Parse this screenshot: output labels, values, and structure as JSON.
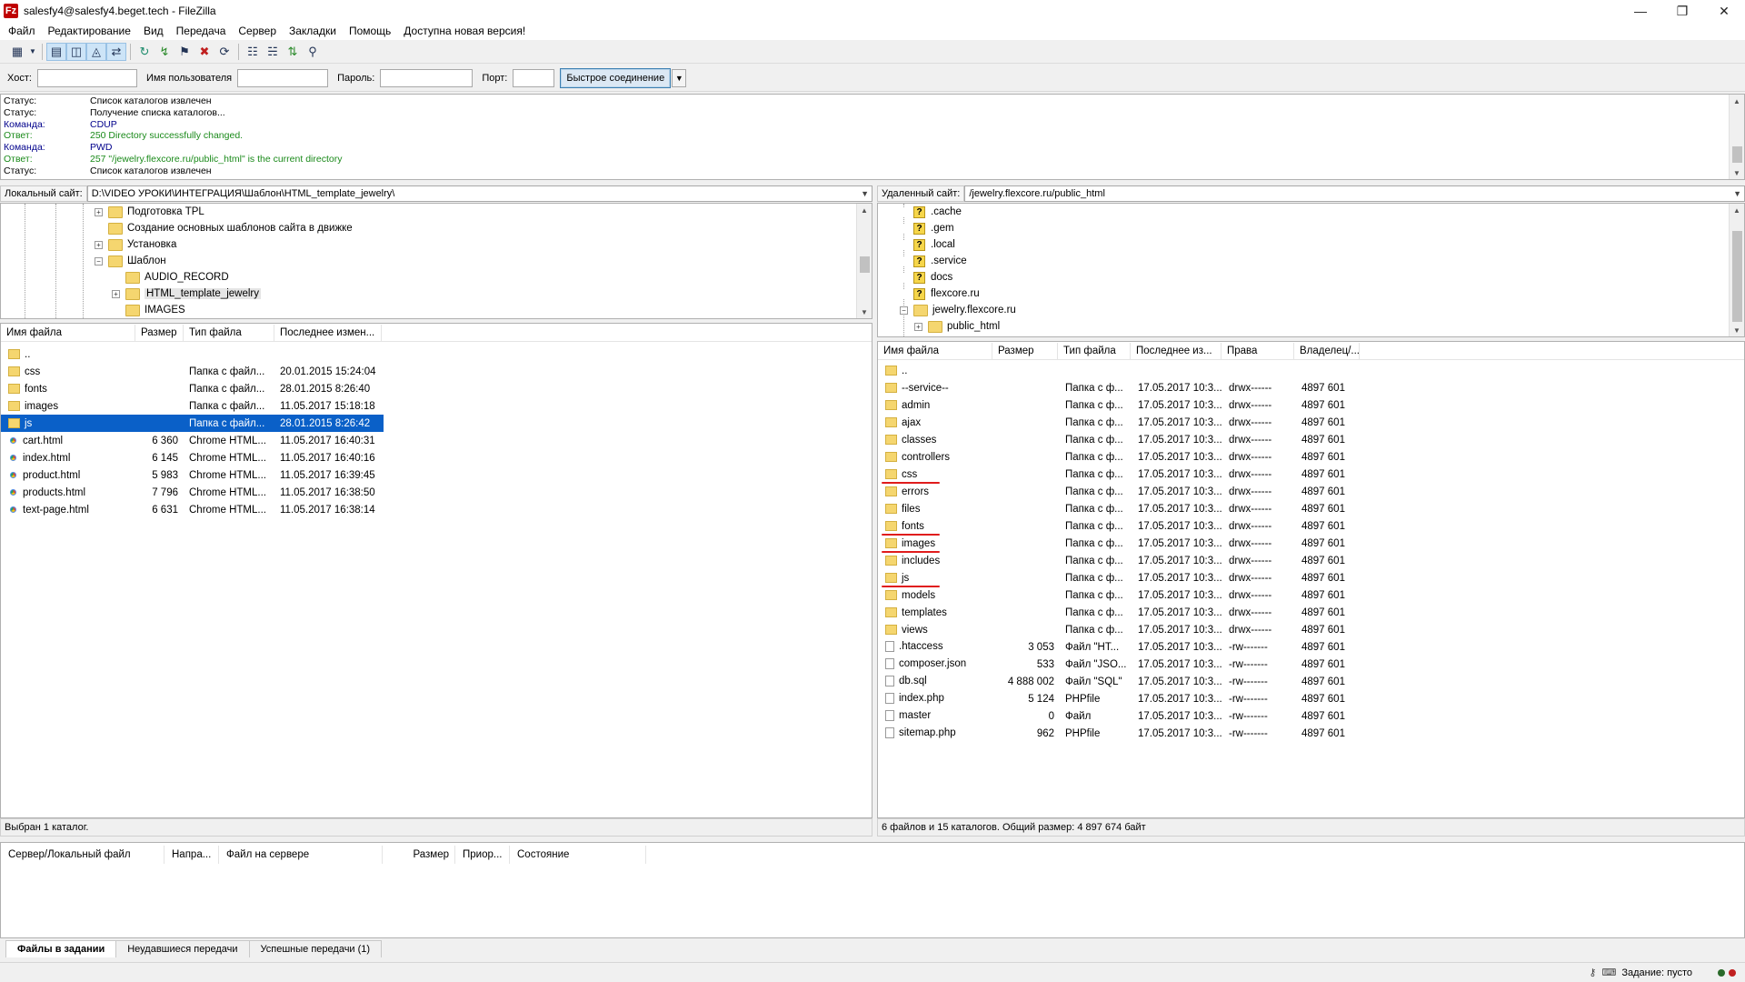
{
  "window": {
    "title": "salesfy4@salesfy4.beget.tech - FileZilla"
  },
  "menu": [
    "Файл",
    "Редактирование",
    "Вид",
    "Передача",
    "Сервер",
    "Закладки",
    "Помощь",
    "Доступна новая версия!"
  ],
  "quickconnect": {
    "host_label": "Хост:",
    "host_value": "",
    "user_label": "Имя пользователя",
    "user_value": "",
    "pass_label": "Пароль:",
    "pass_value": "",
    "port_label": "Порт:",
    "port_value": "",
    "connect_label": "Быстрое соединение"
  },
  "log": [
    {
      "type": "Статус:",
      "msg": "Список каталогов извлечен",
      "kind": "status"
    },
    {
      "type": "Статус:",
      "msg": "Получение списка каталогов...",
      "kind": "status"
    },
    {
      "type": "Команда:",
      "msg": "CDUP",
      "kind": "cmd"
    },
    {
      "type": "Ответ:",
      "msg": "250 Directory successfully changed.",
      "kind": "resp"
    },
    {
      "type": "Команда:",
      "msg": "PWD",
      "kind": "cmd"
    },
    {
      "type": "Ответ:",
      "msg": "257 \"/jewelry.flexcore.ru/public_html\" is the current directory",
      "kind": "resp"
    },
    {
      "type": "Статус:",
      "msg": "Список каталогов извлечен",
      "kind": "status"
    }
  ],
  "local": {
    "site_label": "Локальный сайт:",
    "path": "D:\\VIDEO УРОКИ\\ИНТЕГРАЦИЯ\\Шаблон\\HTML_template_jewelry\\",
    "tree": [
      {
        "label": "Подготовка TPL",
        "level": 0,
        "exp": "+"
      },
      {
        "label": "Создание основных шаблонов сайта в движке",
        "level": 0,
        "exp": ""
      },
      {
        "label": "Установка",
        "level": 0,
        "exp": "+"
      },
      {
        "label": "Шаблон",
        "level": 0,
        "exp": "−"
      },
      {
        "label": "AUDIO_RECORD",
        "level": 1,
        "exp": ""
      },
      {
        "label": "HTML_template_jewelry",
        "level": 1,
        "exp": "+",
        "selected": true
      },
      {
        "label": "IMAGES",
        "level": 1,
        "exp": ""
      }
    ],
    "columns": [
      "Имя файла",
      "Размер",
      "Тип файла",
      "Последнее измен..."
    ],
    "files": [
      {
        "name": "..",
        "size": "",
        "type": "",
        "modified": "",
        "icon": "folder"
      },
      {
        "name": "css",
        "size": "",
        "type": "Папка с файл...",
        "modified": "20.01.2015 15:24:04",
        "icon": "folder"
      },
      {
        "name": "fonts",
        "size": "",
        "type": "Папка с файл...",
        "modified": "28.01.2015 8:26:40",
        "icon": "folder"
      },
      {
        "name": "images",
        "size": "",
        "type": "Папка с файл...",
        "modified": "11.05.2017 15:18:18",
        "icon": "folder"
      },
      {
        "name": "js",
        "size": "",
        "type": "Папка с файл...",
        "modified": "28.01.2015 8:26:42",
        "icon": "folder",
        "selected": true
      },
      {
        "name": "cart.html",
        "size": "6 360",
        "type": "Chrome HTML...",
        "modified": "11.05.2017 16:40:31",
        "icon": "chrome"
      },
      {
        "name": "index.html",
        "size": "6 145",
        "type": "Chrome HTML...",
        "modified": "11.05.2017 16:40:16",
        "icon": "chrome"
      },
      {
        "name": "product.html",
        "size": "5 983",
        "type": "Chrome HTML...",
        "modified": "11.05.2017 16:39:45",
        "icon": "chrome"
      },
      {
        "name": "products.html",
        "size": "7 796",
        "type": "Chrome HTML...",
        "modified": "11.05.2017 16:38:50",
        "icon": "chrome"
      },
      {
        "name": "text-page.html",
        "size": "6 631",
        "type": "Chrome HTML...",
        "modified": "11.05.2017 16:38:14",
        "icon": "chrome"
      }
    ],
    "status": "Выбран 1 каталог."
  },
  "remote": {
    "site_label": "Удаленный сайт:",
    "path": "/jewelry.flexcore.ru/public_html",
    "tree": [
      {
        "label": ".cache",
        "icon": "q"
      },
      {
        "label": ".gem",
        "icon": "q"
      },
      {
        "label": ".local",
        "icon": "q"
      },
      {
        "label": ".service",
        "icon": "q"
      },
      {
        "label": "docs",
        "icon": "q"
      },
      {
        "label": "flexcore.ru",
        "icon": "q"
      },
      {
        "label": "jewelry.flexcore.ru",
        "icon": "folder",
        "exp": "−"
      },
      {
        "label": "public_html",
        "icon": "folder",
        "exp": "+",
        "child": true
      }
    ],
    "columns": [
      "Имя файла",
      "Размер",
      "Тип файла",
      "Последнее из...",
      "Права",
      "Владелец/..."
    ],
    "files": [
      {
        "name": "..",
        "size": "",
        "type": "",
        "modified": "",
        "perms": "",
        "owner": "",
        "icon": "folder"
      },
      {
        "name": "--service--",
        "size": "",
        "type": "Папка с ф...",
        "modified": "17.05.2017 10:3...",
        "perms": "drwx------",
        "owner": "4897 601",
        "icon": "folder"
      },
      {
        "name": "admin",
        "size": "",
        "type": "Папка с ф...",
        "modified": "17.05.2017 10:3...",
        "perms": "drwx------",
        "owner": "4897 601",
        "icon": "folder"
      },
      {
        "name": "ajax",
        "size": "",
        "type": "Папка с ф...",
        "modified": "17.05.2017 10:3...",
        "perms": "drwx------",
        "owner": "4897 601",
        "icon": "folder"
      },
      {
        "name": "classes",
        "size": "",
        "type": "Папка с ф...",
        "modified": "17.05.2017 10:3...",
        "perms": "drwx------",
        "owner": "4897 601",
        "icon": "folder"
      },
      {
        "name": "controllers",
        "size": "",
        "type": "Папка с ф...",
        "modified": "17.05.2017 10:3...",
        "perms": "drwx------",
        "owner": "4897 601",
        "icon": "folder"
      },
      {
        "name": "css",
        "size": "",
        "type": "Папка с ф...",
        "modified": "17.05.2017 10:3...",
        "perms": "drwx------",
        "owner": "4897 601",
        "icon": "folder",
        "marked": true
      },
      {
        "name": "errors",
        "size": "",
        "type": "Папка с ф...",
        "modified": "17.05.2017 10:3...",
        "perms": "drwx------",
        "owner": "4897 601",
        "icon": "folder"
      },
      {
        "name": "files",
        "size": "",
        "type": "Папка с ф...",
        "modified": "17.05.2017 10:3...",
        "perms": "drwx------",
        "owner": "4897 601",
        "icon": "folder"
      },
      {
        "name": "fonts",
        "size": "",
        "type": "Папка с ф...",
        "modified": "17.05.2017 10:3...",
        "perms": "drwx------",
        "owner": "4897 601",
        "icon": "folder",
        "marked": true
      },
      {
        "name": "images",
        "size": "",
        "type": "Папка с ф...",
        "modified": "17.05.2017 10:3...",
        "perms": "drwx------",
        "owner": "4897 601",
        "icon": "folder",
        "marked": true
      },
      {
        "name": "includes",
        "size": "",
        "type": "Папка с ф...",
        "modified": "17.05.2017 10:3...",
        "perms": "drwx------",
        "owner": "4897 601",
        "icon": "folder"
      },
      {
        "name": "js",
        "size": "",
        "type": "Папка с ф...",
        "modified": "17.05.2017 10:3...",
        "perms": "drwx------",
        "owner": "4897 601",
        "icon": "folder",
        "marked": true
      },
      {
        "name": "models",
        "size": "",
        "type": "Папка с ф...",
        "modified": "17.05.2017 10:3...",
        "perms": "drwx------",
        "owner": "4897 601",
        "icon": "folder"
      },
      {
        "name": "templates",
        "size": "",
        "type": "Папка с ф...",
        "modified": "17.05.2017 10:3...",
        "perms": "drwx------",
        "owner": "4897 601",
        "icon": "folder"
      },
      {
        "name": "views",
        "size": "",
        "type": "Папка с ф...",
        "modified": "17.05.2017 10:3...",
        "perms": "drwx------",
        "owner": "4897 601",
        "icon": "folder"
      },
      {
        "name": ".htaccess",
        "size": "3 053",
        "type": "Файл \"HT...",
        "modified": "17.05.2017 10:3...",
        "perms": "-rw-------",
        "owner": "4897 601",
        "icon": "file"
      },
      {
        "name": "composer.json",
        "size": "533",
        "type": "Файл \"JSO...",
        "modified": "17.05.2017 10:3...",
        "perms": "-rw-------",
        "owner": "4897 601",
        "icon": "file"
      },
      {
        "name": "db.sql",
        "size": "4 888 002",
        "type": "Файл \"SQL\"",
        "modified": "17.05.2017 10:3...",
        "perms": "-rw-------",
        "owner": "4897 601",
        "icon": "file"
      },
      {
        "name": "index.php",
        "size": "5 124",
        "type": "PHPfile",
        "modified": "17.05.2017 10:3...",
        "perms": "-rw-------",
        "owner": "4897 601",
        "icon": "file"
      },
      {
        "name": "master",
        "size": "0",
        "type": "Файл",
        "modified": "17.05.2017 10:3...",
        "perms": "-rw-------",
        "owner": "4897 601",
        "icon": "file"
      },
      {
        "name": "sitemap.php",
        "size": "962",
        "type": "PHPfile",
        "modified": "17.05.2017 10:3...",
        "perms": "-rw-------",
        "owner": "4897 601",
        "icon": "file"
      }
    ],
    "status": "6 файлов и 15 каталогов. Общий размер: 4 897 674 байт"
  },
  "queue": {
    "columns": [
      "Сервер/Локальный файл",
      "Напра...",
      "Файл на сервере",
      "Размер",
      "Приор...",
      "Состояние"
    ],
    "tabs": [
      "Файлы в задании",
      "Неудавшиеся передачи",
      "Успешные передачи (1)"
    ]
  },
  "statusbar": {
    "queue_text": "Задание: пусто"
  },
  "colors": {
    "selection": "#0a60c8",
    "annotation": "#e01c1c",
    "log_response": "#1a8a1a",
    "log_command": "#00008b"
  }
}
